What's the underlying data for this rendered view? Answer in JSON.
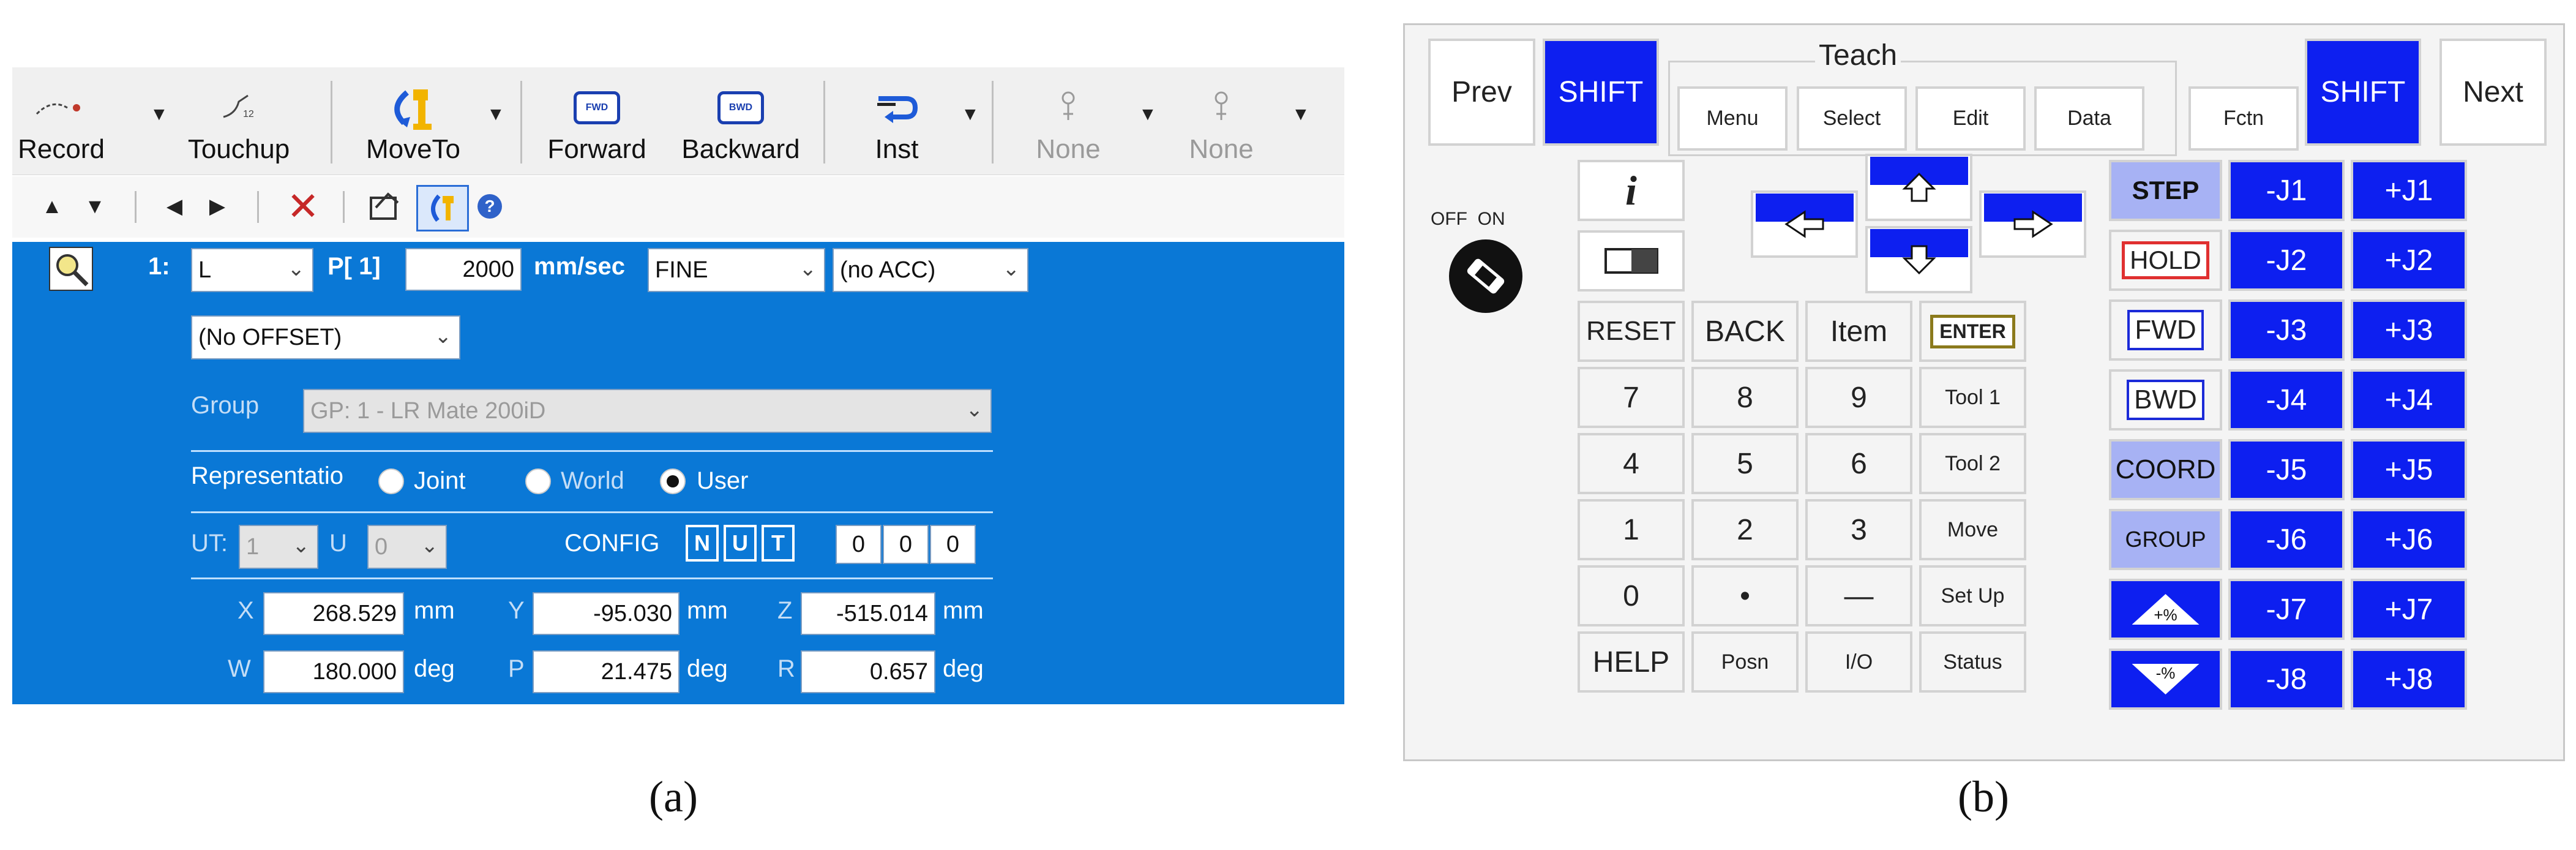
{
  "panel_a": {
    "caption": "(a)",
    "toolbar": {
      "record": "Record",
      "touchup": "Touchup",
      "moveto": "MoveTo",
      "forward": "Forward",
      "forward_icon": "FWD",
      "backward": "Backward",
      "backward_icon": "BWD",
      "inst": "Inst",
      "none1": "None",
      "none2": "None"
    },
    "editor": {
      "line_number": "1:",
      "motion_type": "L",
      "position": "P[ 1]",
      "speed": "2000",
      "speed_unit": "mm/sec",
      "termination": "FINE",
      "acc": "(no ACC)",
      "offset": "(No OFFSET)",
      "group_label": "Group",
      "group_value": "GP: 1 - LR Mate 200iD",
      "repr_label": "Representatio",
      "repr_joint": "Joint",
      "repr_world": "World",
      "repr_user": "User",
      "ut_label": "UT:",
      "ut_value": "1",
      "uf_label": "U",
      "uf_value": "0",
      "config_label": "CONFIG",
      "config_n": "N",
      "config_u": "U",
      "config_t": "T",
      "config_v1": "0",
      "config_v2": "0",
      "config_v3": "0",
      "x_label": "X",
      "x_value": "268.529",
      "x_unit": "mm",
      "y_label": "Y",
      "y_value": "-95.030",
      "y_unit": "mm",
      "z_label": "Z",
      "z_value": "-515.014",
      "z_unit": "mm",
      "w_label": "W",
      "w_value": "180.000",
      "w_unit": "deg",
      "p_label": "P",
      "p_value": "21.475",
      "p_unit": "deg",
      "r_label": "R",
      "r_value": "0.657",
      "r_unit": "deg"
    }
  },
  "panel_b": {
    "caption": "(b)",
    "teach_label": "Teach",
    "keys": {
      "prev": "Prev",
      "shift1": "SHIFT",
      "menu": "Menu",
      "select": "Select",
      "edit": "Edit",
      "data": "Data",
      "fctn": "Fctn",
      "shift2": "SHIFT",
      "next": "Next",
      "info": "i",
      "off_on": "OFF  ON",
      "reset": "RESET",
      "back": "BACK",
      "item": "Item",
      "enter": "ENTER",
      "n7": "7",
      "n8": "8",
      "n9": "9",
      "tool1": "Tool 1",
      "n4": "4",
      "n5": "5",
      "n6": "6",
      "tool2": "Tool 2",
      "n1": "1",
      "n2": "2",
      "n3": "3",
      "move": "Move",
      "n0": "0",
      "dot": "•",
      "dash": "—",
      "setup": "Set Up",
      "help": "HELP",
      "posn": "Posn",
      "io": "I/O",
      "status": "Status",
      "step": "STEP",
      "hold": "HOLD",
      "fwd": "FWD",
      "bwd": "BWD",
      "coord": "COORD",
      "group": "GROUP",
      "plus_pct": "+%",
      "minus_pct": "-%",
      "jm1": "-J1",
      "jp1": "+J1",
      "jm2": "-J2",
      "jp2": "+J2",
      "jm3": "-J3",
      "jp3": "+J3",
      "jm4": "-J4",
      "jp4": "+J4",
      "jm5": "-J5",
      "jp5": "+J5",
      "jm6": "-J6",
      "jp6": "+J6",
      "jm7": "-J7",
      "jp7": "+J7",
      "jm8": "-J8",
      "jp8": "+J8"
    }
  }
}
